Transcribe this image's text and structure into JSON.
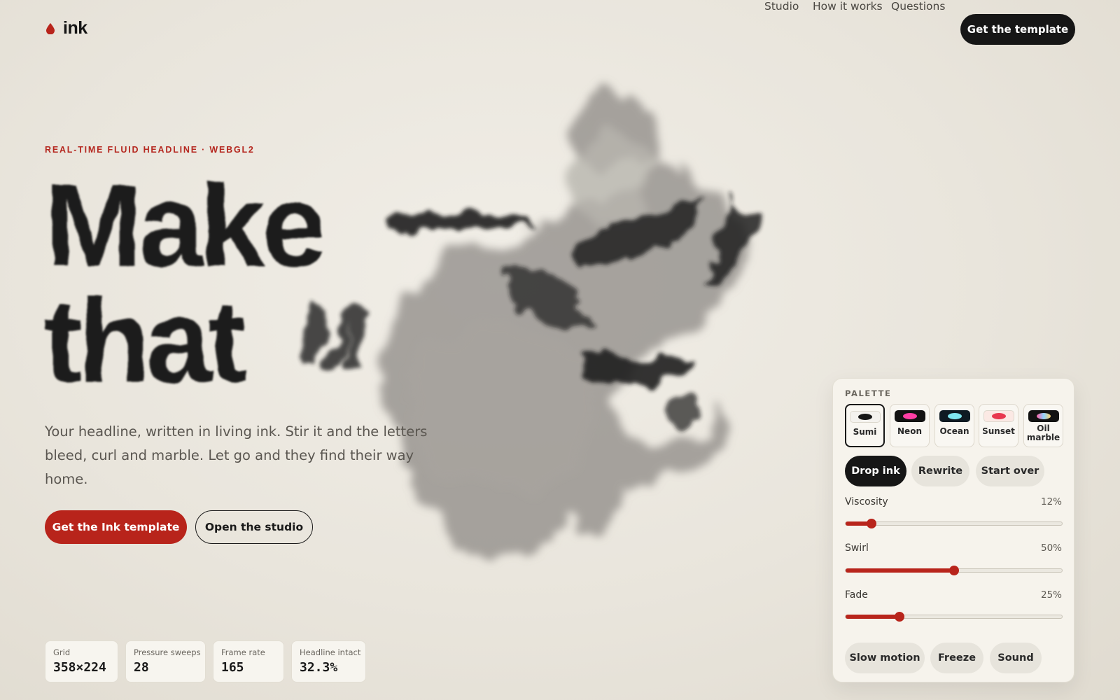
{
  "nav": {
    "brand": "ink",
    "links": [
      "Studio",
      "How it works",
      "Questions"
    ],
    "cta": "Get the template"
  },
  "hero": {
    "eyebrow": "REAL-TIME FLUID HEADLINE · WEBGL2",
    "headline_line1": "Make",
    "headline_line2": "that",
    "subheadline": "Your headline, written in living ink. Stir it and the letters bleed, curl and marble. Let go and they find their way home.",
    "primary_cta": "Get the Ink template",
    "secondary_cta": "Open the studio"
  },
  "stats": [
    {
      "label": "Grid",
      "value": "358×224"
    },
    {
      "label": "Pressure sweeps",
      "value": "28"
    },
    {
      "label": "Frame rate",
      "value": "165"
    },
    {
      "label": "Headline intact",
      "value": "32.3%"
    }
  ],
  "panel": {
    "title": "PALETTE",
    "palettes": [
      {
        "label": "Sumi",
        "selected": true,
        "bg": "#f4f2ee",
        "dot": "#161616"
      },
      {
        "label": "Neon",
        "selected": false,
        "bg": "#121212",
        "dot": "#ff3ea5"
      },
      {
        "label": "Ocean",
        "selected": false,
        "bg": "#0e1a22",
        "dot": "#7ee6ef"
      },
      {
        "label": "Sunset",
        "selected": false,
        "bg": "#fbe9e4",
        "dot": "#e8384f"
      },
      {
        "label": "Oil marble",
        "selected": false,
        "bg": "#121212",
        "dot": "#9ad6b4"
      }
    ],
    "actions": [
      "Drop ink",
      "Rewrite",
      "Start over"
    ],
    "sliders": [
      {
        "label": "Viscosity",
        "value_text": "12%",
        "value": 0.12
      },
      {
        "label": "Swirl",
        "value_text": "50%",
        "value": 0.5
      },
      {
        "label": "Fade",
        "value_text": "25%",
        "value": 0.25
      }
    ],
    "toggles": [
      "Slow motion",
      "Freeze",
      "Sound"
    ]
  },
  "colors": {
    "accent": "#b8241b",
    "ink": "#161616",
    "background": "#ece8e0"
  }
}
